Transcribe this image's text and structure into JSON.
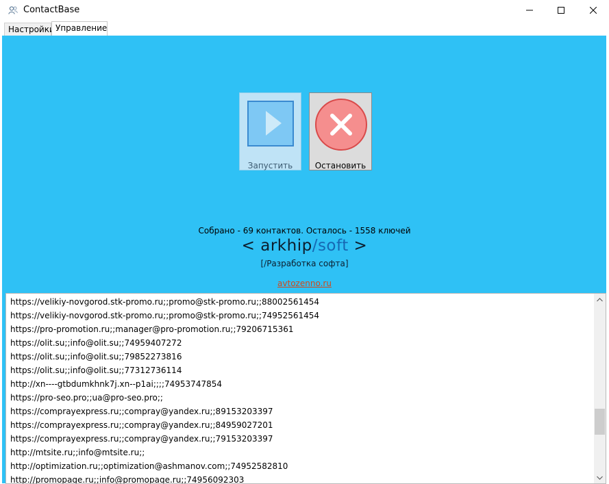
{
  "window": {
    "title": "ContactBase"
  },
  "tabs": [
    {
      "label": "Настройки",
      "active": false
    },
    {
      "label": "Управление",
      "active": true
    }
  ],
  "controls": {
    "start_label": "Запустить",
    "stop_label": "Остановить"
  },
  "status_text": "Собрано - 69 контактов. Осталось - 1558 ключей",
  "brand": {
    "open": "< arkhip",
    "slash": "/",
    "soft": "soft",
    "close": " >",
    "tagline": "[/Разработка софта]",
    "link": "avtozenno.ru"
  },
  "colors": {
    "panel_bg": "#2fc1f5",
    "stop_red": "#f58e8e",
    "start_blue": "#7ec8f4"
  },
  "log_lines": [
    "https://velikiy-novgorod.stk-promo.ru;;promo@stk-promo.ru;;88002561454",
    "https://velikiy-novgorod.stk-promo.ru;;promo@stk-promo.ru;;74952561454",
    "https://pro-promotion.ru;;manager@pro-promotion.ru;;79206715361",
    "https://olit.su;;info@olit.su;;74959407272",
    "https://olit.su;;info@olit.su;;79852273816",
    "https://olit.su;;info@olit.su;;77312736114",
    "http://xn----gtbdumkhnk7j.xn--p1ai;;;;74953747854",
    "https://pro-seo.pro;;ua@pro-seo.pro;;",
    "https://comprayexpress.ru;;compray@yandex.ru;;89153203397",
    "https://comprayexpress.ru;;compray@yandex.ru;;84959027201",
    "https://comprayexpress.ru;;compray@yandex.ru;;79153203397",
    "http://mtsite.ru;;info@mtsite.ru;;",
    "http://optimization.ru;;optimization@ashmanov.com;;74952582810",
    "http://promopage.ru;;info@promopage.ru;;74956092303"
  ]
}
